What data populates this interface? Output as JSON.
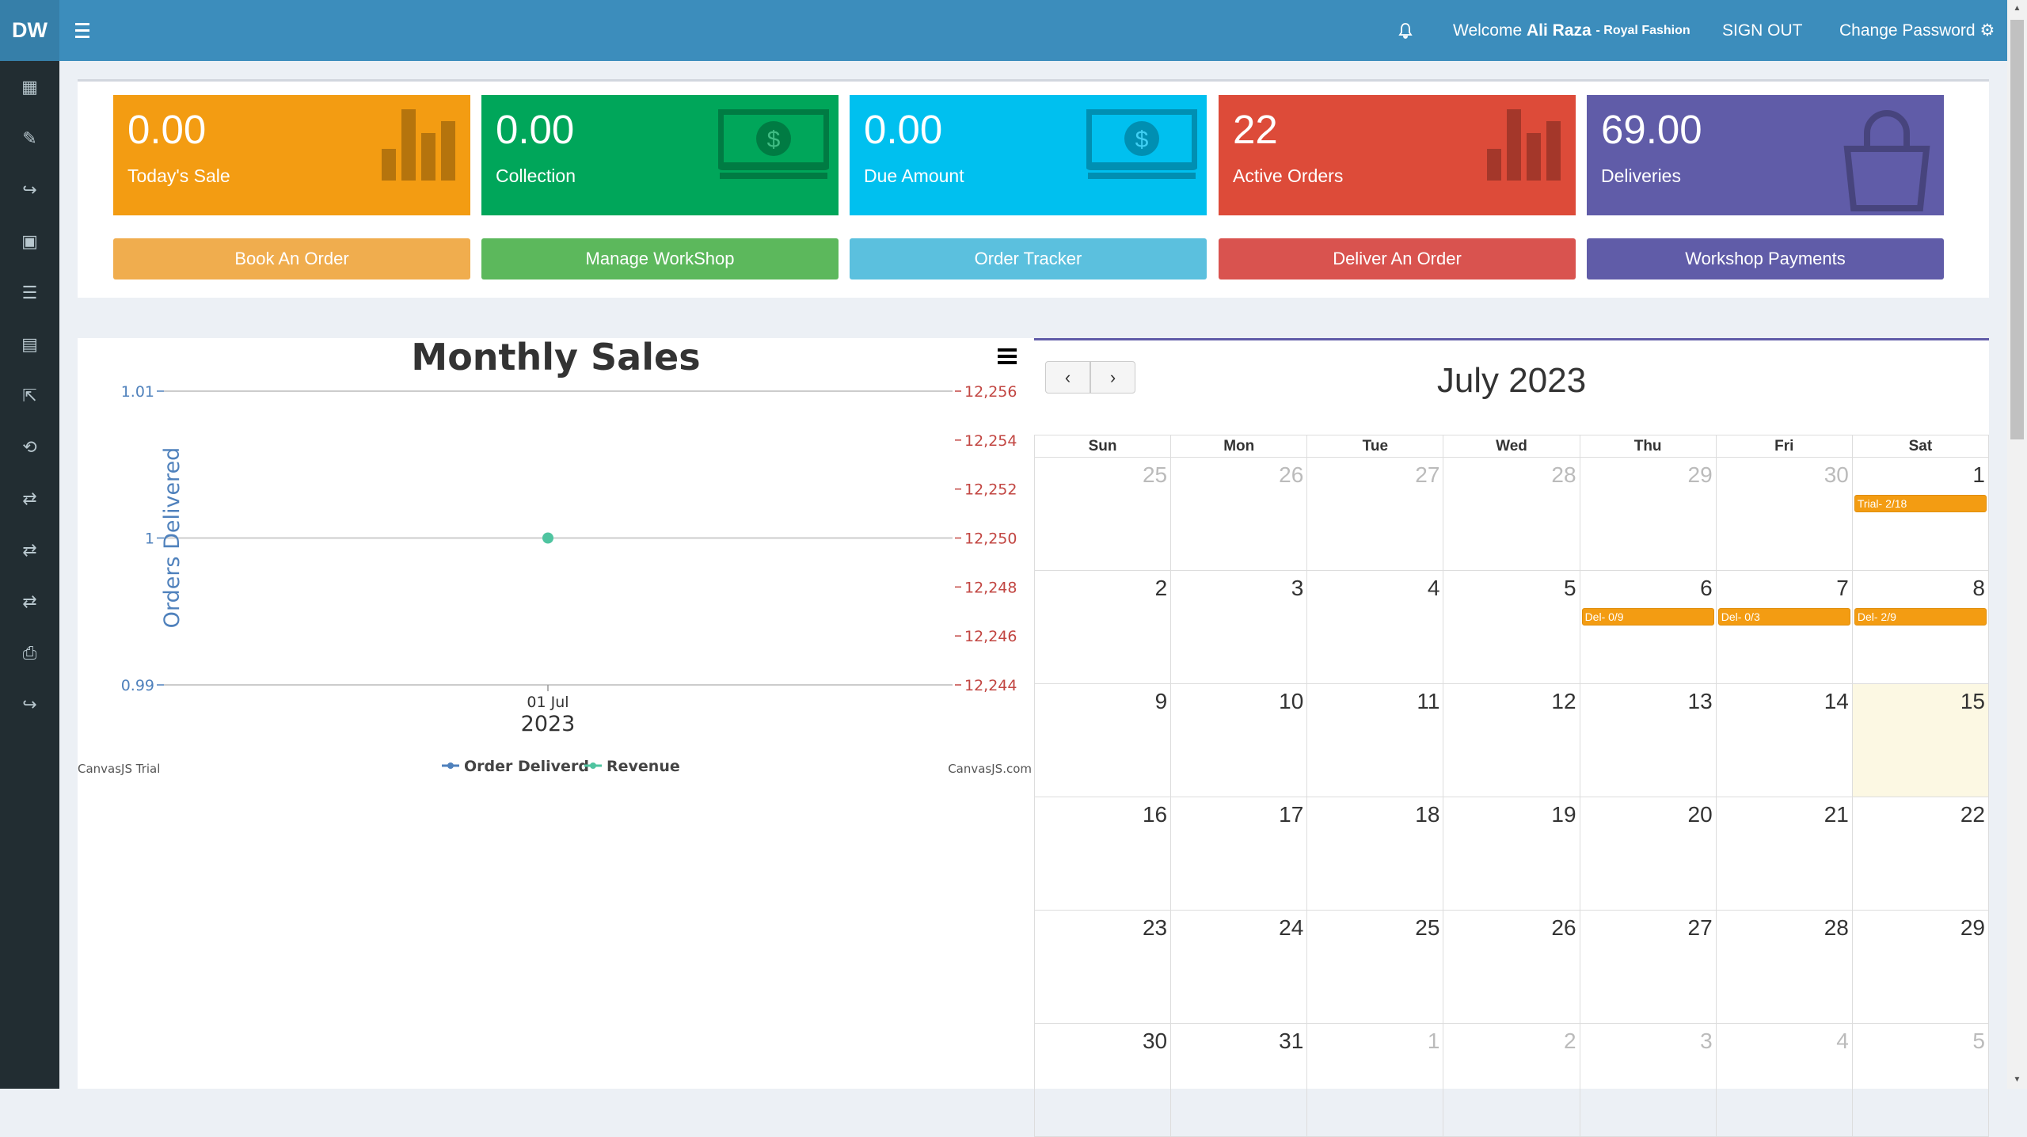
{
  "app": {
    "logo": "DW"
  },
  "topbar": {
    "welcome_prefix": "Welcome",
    "user_name": "Ali Raza",
    "company": "- Royal Fashion",
    "sign_out": "SIGN OUT",
    "change_password": "Change Password"
  },
  "sidebar": {
    "icons": [
      "dashboard-grid-icon",
      "edit-icon",
      "share-icon",
      "qrcode-icon",
      "server-icon",
      "list-icon",
      "external-link-icon",
      "retweet-icon",
      "exchange-icon",
      "exchange-icon",
      "exchange-icon",
      "print-icon",
      "share-icon"
    ]
  },
  "stats": [
    {
      "value": "0.00",
      "label": "Today's Sale",
      "color": "#f39c12",
      "icon": "bar-chart-icon"
    },
    {
      "value": "0.00",
      "label": "Collection",
      "color": "#00a65a",
      "icon": "money-icon"
    },
    {
      "value": "0.00",
      "label": "Due Amount",
      "color": "#00c0ef",
      "icon": "money-icon"
    },
    {
      "value": "22",
      "label": "Active Orders",
      "color": "#dd4b39",
      "icon": "bar-chart-icon"
    },
    {
      "value": "69.00",
      "label": "Deliveries",
      "color": "#605ca8",
      "icon": "shopping-bag-icon"
    }
  ],
  "actions": [
    {
      "label": "Book An Order",
      "color": "#f0ad4e"
    },
    {
      "label": "Manage WorkShop",
      "color": "#5cb85c"
    },
    {
      "label": "Order Tracker",
      "color": "#5bc0de"
    },
    {
      "label": "Deliver An Order",
      "color": "#d9534f"
    },
    {
      "label": "Workshop Payments",
      "color": "#605ca8"
    }
  ],
  "chart_data": {
    "type": "line",
    "title": "Monthly Sales",
    "ylabel": "Orders Delivered",
    "y2label": "Revenue",
    "x_tick_label": "01 Jul",
    "x_tick_year": "2023",
    "y_ticks": [
      "1.01",
      "1",
      "0.99"
    ],
    "y2_ticks": [
      "12,256",
      "12,254",
      "12,252",
      "12,250",
      "12,248",
      "12,246",
      "12,244"
    ],
    "ylim": [
      0.99,
      1.01
    ],
    "y2lim": [
      12244,
      12256
    ],
    "series": [
      {
        "name": "Order Deliverd",
        "color": "#4f81bc",
        "x": [
          "2023-07-01"
        ],
        "values": [
          1
        ]
      },
      {
        "name": "Revenue",
        "color": "#4fc4a0",
        "x": [
          "2023-07-01"
        ],
        "values": [
          12250
        ]
      }
    ],
    "credit_left": "CanvasJS Trial",
    "credit_right": "CanvasJS.com"
  },
  "calendar": {
    "title": "July 2023",
    "weekdays": [
      "Sun",
      "Mon",
      "Tue",
      "Wed",
      "Thu",
      "Fri",
      "Sat"
    ],
    "weeks": [
      [
        {
          "d": "25",
          "o": true
        },
        {
          "d": "26",
          "o": true
        },
        {
          "d": "27",
          "o": true
        },
        {
          "d": "28",
          "o": true
        },
        {
          "d": "29",
          "o": true
        },
        {
          "d": "30",
          "o": true
        },
        {
          "d": "1",
          "e": "Trial- 2/18"
        }
      ],
      [
        {
          "d": "2"
        },
        {
          "d": "3"
        },
        {
          "d": "4"
        },
        {
          "d": "5"
        },
        {
          "d": "6",
          "e": "Del- 0/9"
        },
        {
          "d": "7",
          "e": "Del- 0/3"
        },
        {
          "d": "8",
          "e": "Del- 2/9"
        }
      ],
      [
        {
          "d": "9"
        },
        {
          "d": "10"
        },
        {
          "d": "11"
        },
        {
          "d": "12"
        },
        {
          "d": "13"
        },
        {
          "d": "14"
        },
        {
          "d": "15",
          "t": true
        }
      ],
      [
        {
          "d": "16"
        },
        {
          "d": "17"
        },
        {
          "d": "18"
        },
        {
          "d": "19"
        },
        {
          "d": "20"
        },
        {
          "d": "21"
        },
        {
          "d": "22"
        }
      ],
      [
        {
          "d": "23"
        },
        {
          "d": "24"
        },
        {
          "d": "25"
        },
        {
          "d": "26"
        },
        {
          "d": "27"
        },
        {
          "d": "28"
        },
        {
          "d": "29"
        }
      ],
      [
        {
          "d": "30"
        },
        {
          "d": "31"
        },
        {
          "d": "1",
          "o": true
        },
        {
          "d": "2",
          "o": true
        },
        {
          "d": "3",
          "o": true
        },
        {
          "d": "4",
          "o": true
        },
        {
          "d": "5",
          "o": true
        }
      ]
    ]
  }
}
